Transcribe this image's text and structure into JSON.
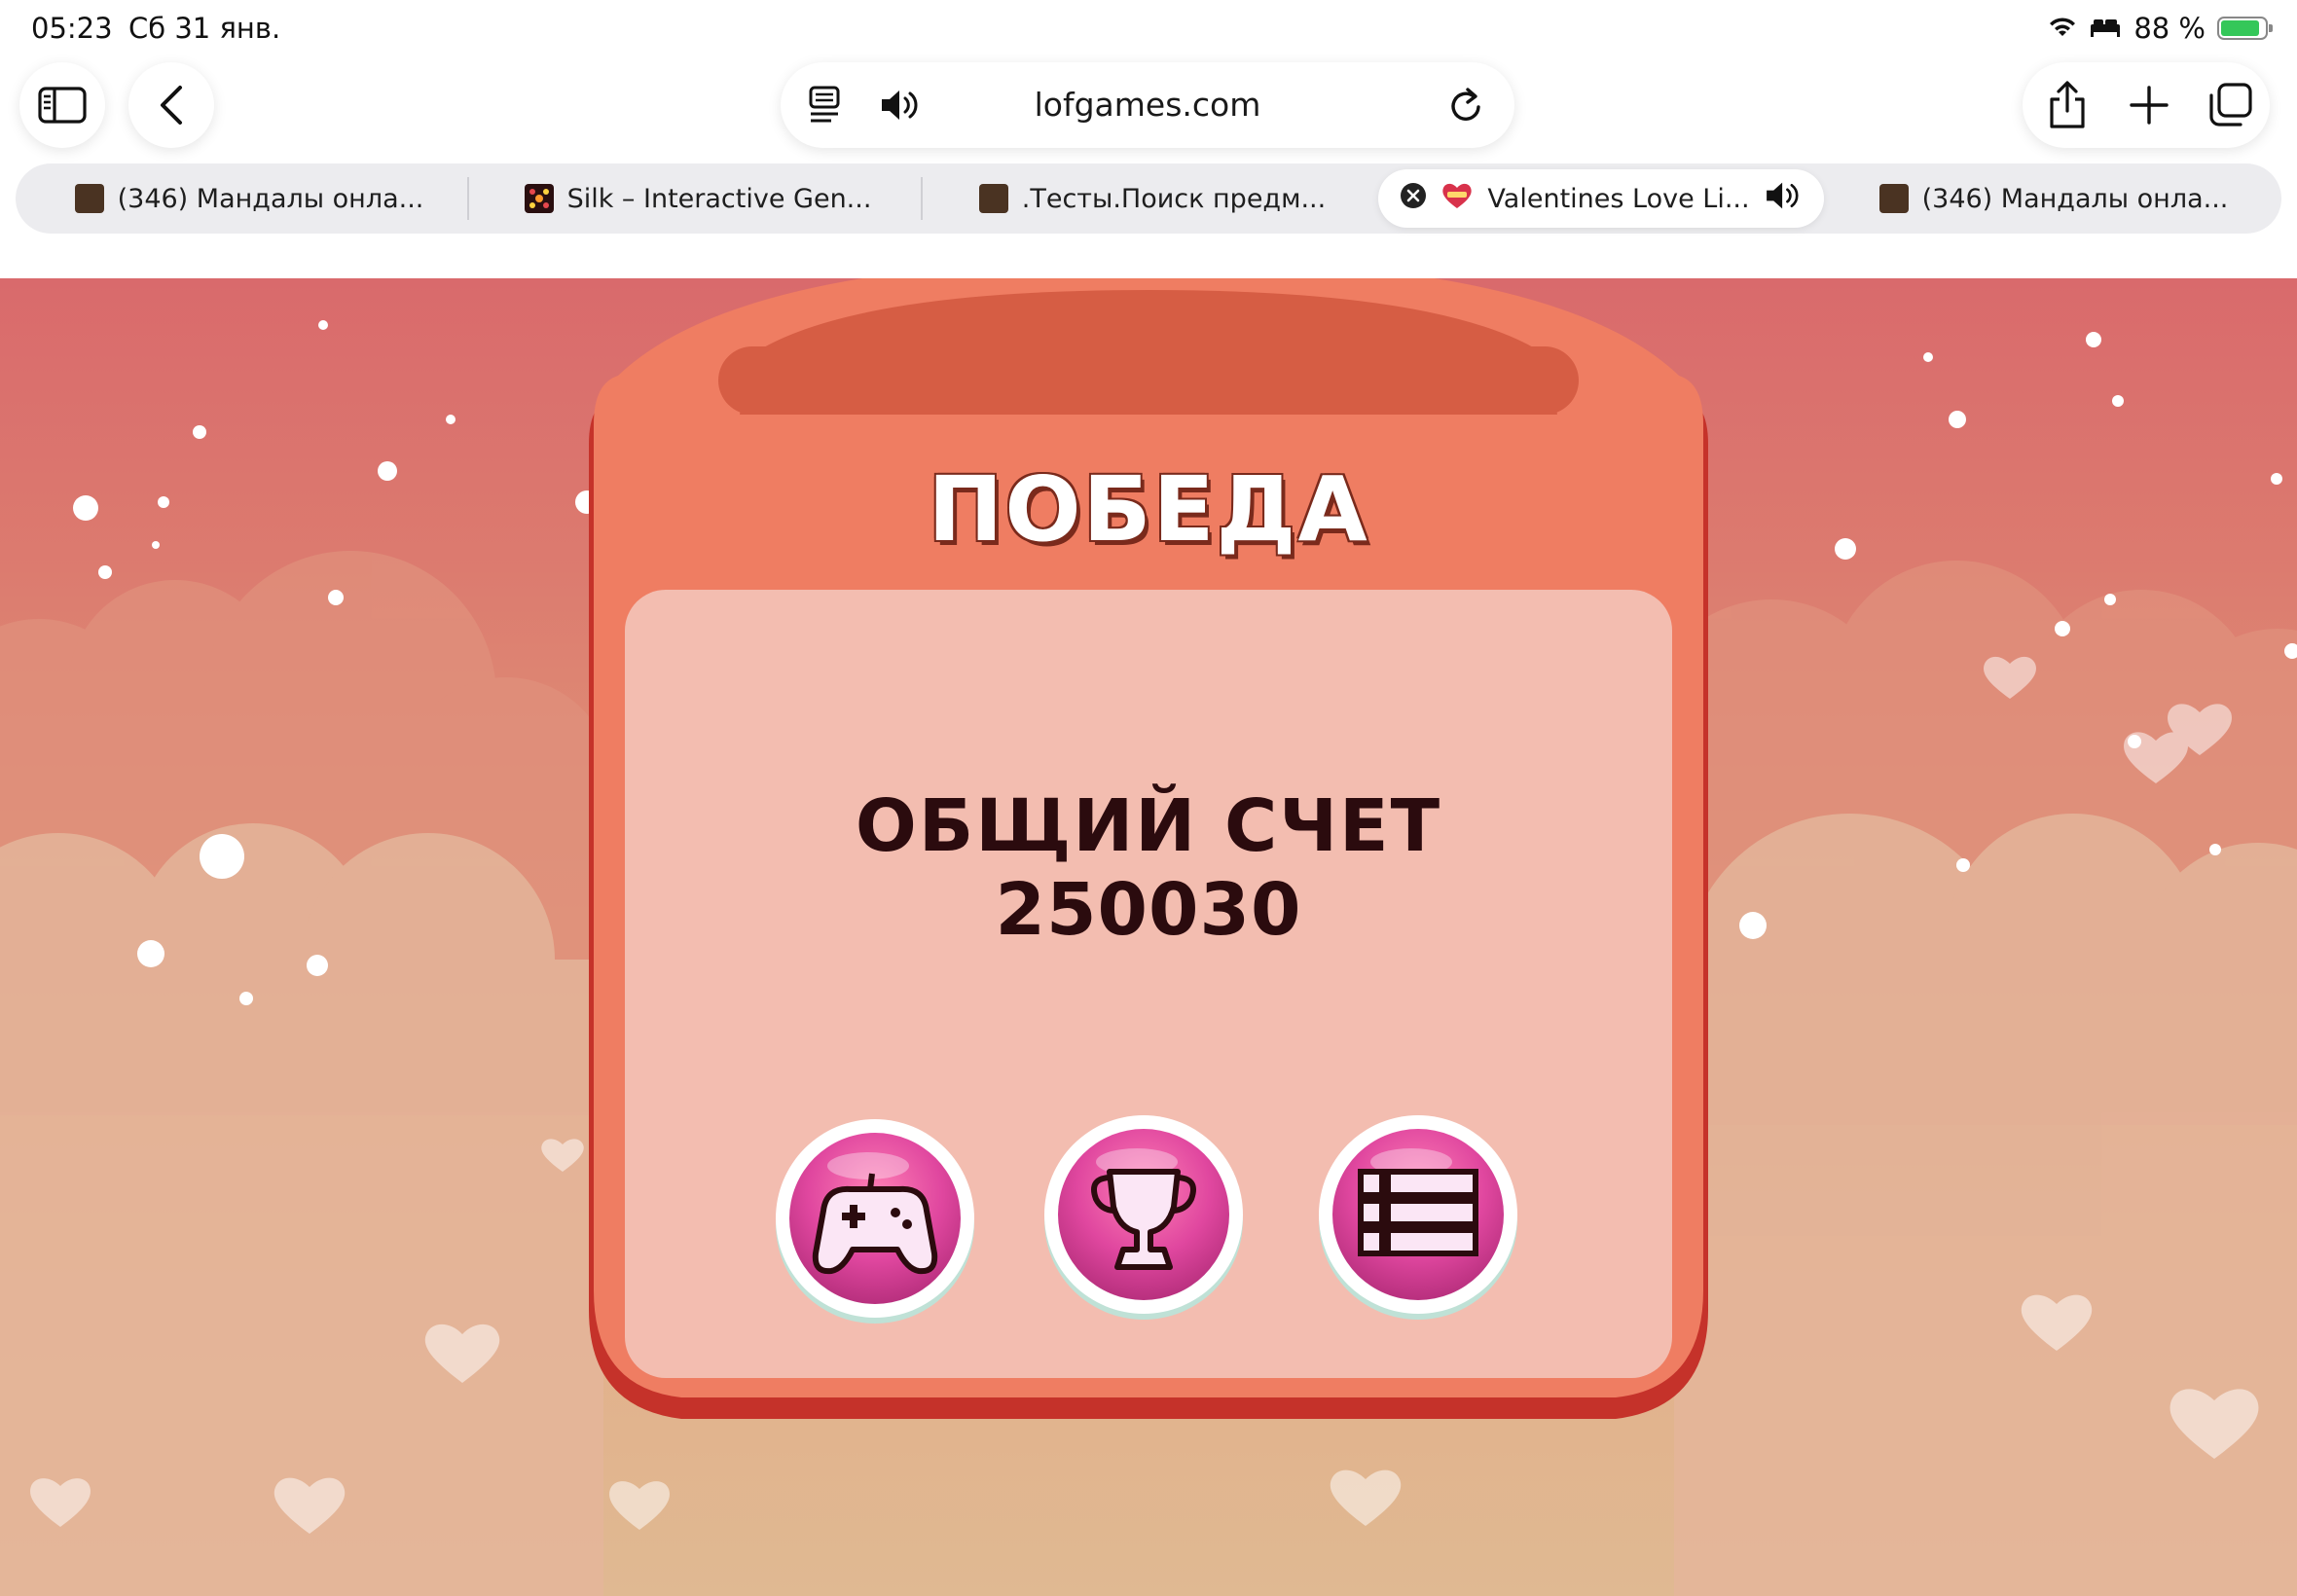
{
  "status_bar": {
    "time": "05:23",
    "date": "Сб 31 янв.",
    "battery": "88 %",
    "battery_level": 0.88
  },
  "toolbar": {
    "url": "lofgames.com"
  },
  "tabs": [
    {
      "title": "(346) Мандалы онла...",
      "active": false
    },
    {
      "title": "Silk – Interactive Gen...",
      "active": false
    },
    {
      "title": ".Тесты.Поиск предм...",
      "active": false
    },
    {
      "title": "Valentines Love Li...",
      "active": true
    },
    {
      "title": "(346) Мандалы онла...",
      "active": false
    }
  ],
  "game": {
    "title": "ПОБЕДА",
    "score_label": "ОБЩИЙ СЧЕТ",
    "score_value": "250030",
    "buttons": [
      {
        "icon": "gamepad-icon"
      },
      {
        "icon": "trophy-icon"
      },
      {
        "icon": "list-icon"
      }
    ]
  },
  "colors": {
    "game_bg_top": "#d96a6c",
    "game_bg_bottom": "#e0b992",
    "panel_frame": "#ef7d62",
    "panel_inner": "#f3bdb0",
    "button_pink": "#e0479f",
    "score_text": "#2b0b0e",
    "battery_green": "#34c759"
  }
}
